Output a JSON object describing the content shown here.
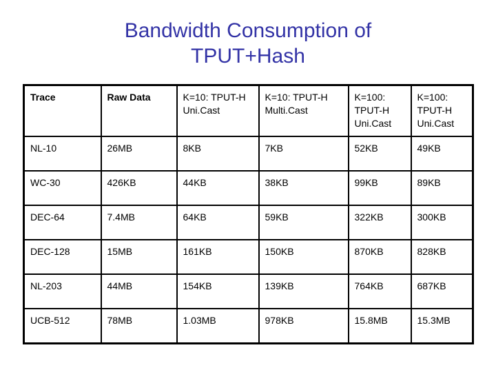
{
  "slide": {
    "title_lines": [
      "Bandwidth Consumption of",
      "TPUT+Hash"
    ],
    "title_color": "#3333a6",
    "background_color": "#ffffff",
    "text_color": "#000000",
    "border_color": "#000000"
  },
  "table": {
    "headers": [
      {
        "lines": [
          "Trace"
        ],
        "bold": true
      },
      {
        "lines": [
          "Raw Data"
        ],
        "bold": true
      },
      {
        "lines": [
          "K=10: TPUT-H",
          "Uni.Cast"
        ],
        "bold": false
      },
      {
        "lines": [
          "K=10: TPUT-H",
          "Multi.Cast"
        ],
        "bold": false
      },
      {
        "lines": [
          "K=100:",
          "TPUT-H",
          "Uni.Cast"
        ],
        "bold": false
      },
      {
        "lines": [
          "K=100:",
          "TPUT-H",
          "Uni.Cast"
        ],
        "bold": false
      }
    ],
    "rows": [
      {
        "cells": [
          "NL-10",
          "26MB",
          "8KB",
          "7KB",
          "52KB",
          "49KB"
        ]
      },
      {
        "cells": [
          "WC-30",
          "426KB",
          "44KB",
          "38KB",
          "99KB",
          "89KB"
        ]
      },
      {
        "cells": [
          "DEC-64",
          "7.4MB",
          "64KB",
          "59KB",
          "322KB",
          "300KB"
        ]
      },
      {
        "cells": [
          "DEC-128",
          "15MB",
          "161KB",
          "150KB",
          "870KB",
          "828KB"
        ]
      },
      {
        "cells": [
          "NL-203",
          "44MB",
          "154KB",
          "139KB",
          "764KB",
          "687KB"
        ]
      },
      {
        "cells": [
          "UCB-512",
          "78MB",
          "1.03MB",
          "978KB",
          "15.8MB",
          "15.3MB"
        ]
      }
    ]
  }
}
